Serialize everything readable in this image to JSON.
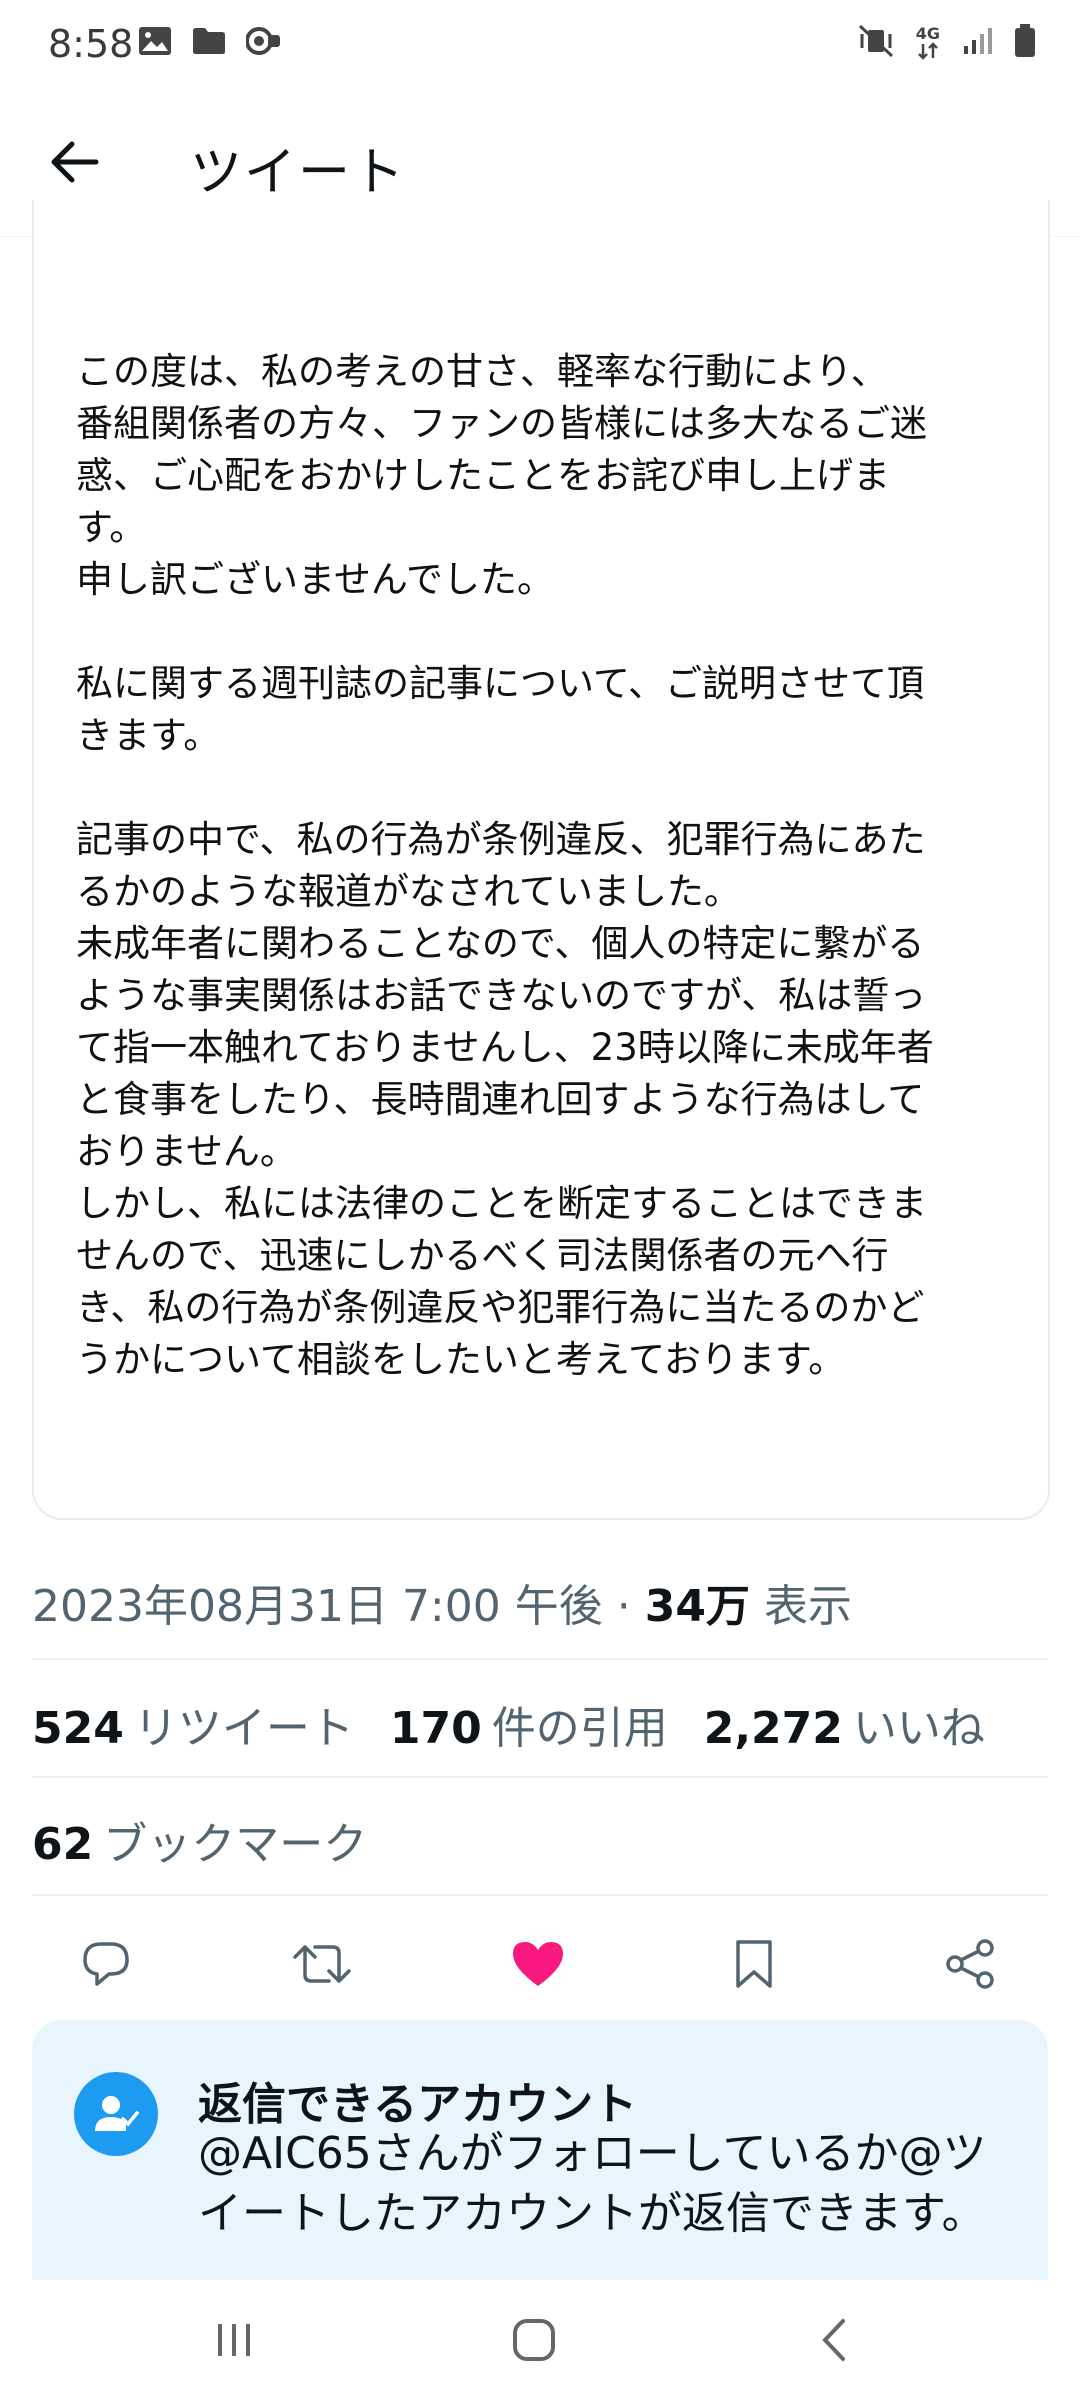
{
  "status_bar": {
    "time": "8:58",
    "left_icons": [
      "image-icon",
      "folder-icon",
      "cast-icon"
    ],
    "right_icons": [
      "mute-vibrate-icon",
      "4g-data-icon",
      "signal-icon",
      "battery-icon"
    ],
    "network_label": "4G"
  },
  "header": {
    "title": "ツイート"
  },
  "statement": {
    "paragraphs": [
      "この度は、私の考えの甘さ、軽率な行動により、\n番組関係者の方々、ファンの皆様には多大なるご迷\n惑、ご心配をおかけしたことをお詫び申し上げま\nす。\n申し訳ございませんでした。",
      "私に関する週刊誌の記事について、ご説明させて頂\nきます。",
      "記事の中で、私の行為が条例違反、犯罪行為にあた\nるかのような報道がなされていました。\n未成年者に関わることなので、個人の特定に繋がる\nような事実関係はお話できないのですが、私は誓っ\nて指一本触れておりませんし、23時以降に未成年者\nと食事をしたり、長時間連れ回すような行為はして\nおりません。\nしかし、私には法律のことを断定することはできま\nせんので、迅速にしかるべく司法関係者の元へ行\nき、私の行為が条例違反や犯罪行為に当たるのかど\nうかについて相談をしたいと考えております。"
    ]
  },
  "meta": {
    "datetime": "2023年08月31日 7:00 午後",
    "separator": " · ",
    "views_count": "34万",
    "views_label": "表示"
  },
  "stats": {
    "retweets_count": "524",
    "retweets_label": "リツイート",
    "quotes_count": "170",
    "quotes_label": "件の引用",
    "likes_count": "2,272",
    "likes_label": "いいね",
    "bookmarks_count": "62",
    "bookmarks_label": "ブックマーク"
  },
  "actions": {
    "items": [
      "reply-icon",
      "retweet-icon",
      "like-icon",
      "bookmark-icon",
      "share-icon"
    ],
    "like_color": "#f91880",
    "icon_color": "#536471"
  },
  "reply_card": {
    "title": "返信できるアカウント",
    "description": "@AIC65さんがフォローしているか@ツイートしたアカウントが返信できます。",
    "accent": "#1d9bf0",
    "background": "#e8f5fd"
  },
  "nav_bar": {
    "items": [
      "recents-icon",
      "home-icon",
      "back-icon"
    ]
  }
}
